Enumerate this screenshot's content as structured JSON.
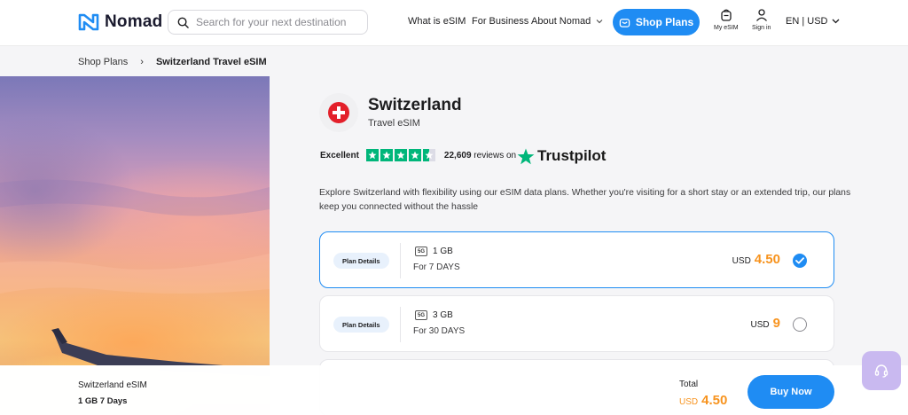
{
  "brand": {
    "name": "Nomad"
  },
  "search": {
    "placeholder": "Search for your next destination"
  },
  "nav": {
    "what_is_esim": "What is eSIM",
    "for_business": "For Business",
    "about": "About Nomad",
    "shop_plans": "Shop Plans",
    "my_esim": "My eSIM",
    "sign_in": "Sign in",
    "language": "EN | USD"
  },
  "breadcrumb": {
    "parent": "Shop Plans",
    "separator": "›",
    "current": "Switzerland Travel eSIM"
  },
  "product": {
    "country": "Switzerland",
    "subtitle": "Travel eSIM"
  },
  "rating": {
    "label": "Excellent",
    "stars": 4.5,
    "review_count": "22,609",
    "reviews_suffix": "reviews on",
    "provider": "Trustpilot"
  },
  "description": "Explore Switzerland with flexibility using our eSIM data plans. Whether you're visiting for a short stay or an extended trip, our plans keep you connected without the hassle",
  "plans": [
    {
      "details_label": "Plan Details",
      "network": "5G",
      "data": "1 GB",
      "days": "For 7 DAYS",
      "currency": "USD",
      "price": "4.50",
      "selected": true
    },
    {
      "details_label": "Plan Details",
      "network": "5G",
      "data": "3 GB",
      "days": "For 30 DAYS",
      "currency": "USD",
      "price": "9",
      "selected": false
    }
  ],
  "summary": {
    "name": "Switzerland eSIM",
    "plan": "1 GB 7 Days",
    "total_label": "Total",
    "currency": "USD",
    "total": "4.50",
    "buy_label": "Buy Now"
  },
  "colors": {
    "accent": "#1f8cf3",
    "price": "#f7931e",
    "trustpilot_green": "#00b67a",
    "flag_red": "#e3202a"
  },
  "icons": [
    "search-icon",
    "chevron-down-icon",
    "shop-icon",
    "my-esim-icon",
    "user-icon",
    "check-icon",
    "star-icon",
    "headset-icon"
  ]
}
